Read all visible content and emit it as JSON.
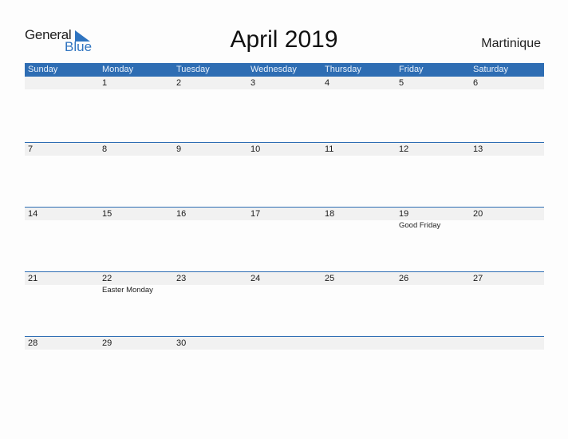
{
  "logo": {
    "line1": "General",
    "line2": "Blue"
  },
  "title": "April 2019",
  "country": "Martinique",
  "weekdays": [
    "Sunday",
    "Monday",
    "Tuesday",
    "Wednesday",
    "Thursday",
    "Friday",
    "Saturday"
  ],
  "weeks": [
    {
      "days": [
        {
          "num": "",
          "event": ""
        },
        {
          "num": "1",
          "event": ""
        },
        {
          "num": "2",
          "event": ""
        },
        {
          "num": "3",
          "event": ""
        },
        {
          "num": "4",
          "event": ""
        },
        {
          "num": "5",
          "event": ""
        },
        {
          "num": "6",
          "event": ""
        }
      ]
    },
    {
      "days": [
        {
          "num": "7",
          "event": ""
        },
        {
          "num": "8",
          "event": ""
        },
        {
          "num": "9",
          "event": ""
        },
        {
          "num": "10",
          "event": ""
        },
        {
          "num": "11",
          "event": ""
        },
        {
          "num": "12",
          "event": ""
        },
        {
          "num": "13",
          "event": ""
        }
      ]
    },
    {
      "days": [
        {
          "num": "14",
          "event": ""
        },
        {
          "num": "15",
          "event": ""
        },
        {
          "num": "16",
          "event": ""
        },
        {
          "num": "17",
          "event": ""
        },
        {
          "num": "18",
          "event": ""
        },
        {
          "num": "19",
          "event": "Good Friday"
        },
        {
          "num": "20",
          "event": ""
        }
      ]
    },
    {
      "days": [
        {
          "num": "21",
          "event": ""
        },
        {
          "num": "22",
          "event": "Easter Monday"
        },
        {
          "num": "23",
          "event": ""
        },
        {
          "num": "24",
          "event": ""
        },
        {
          "num": "25",
          "event": ""
        },
        {
          "num": "26",
          "event": ""
        },
        {
          "num": "27",
          "event": ""
        }
      ]
    },
    {
      "days": [
        {
          "num": "28",
          "event": ""
        },
        {
          "num": "29",
          "event": ""
        },
        {
          "num": "30",
          "event": ""
        },
        {
          "num": "",
          "event": ""
        },
        {
          "num": "",
          "event": ""
        },
        {
          "num": "",
          "event": ""
        },
        {
          "num": "",
          "event": ""
        }
      ]
    }
  ],
  "colors": {
    "accent": "#2e6db3",
    "band": "#f1f1f1"
  }
}
